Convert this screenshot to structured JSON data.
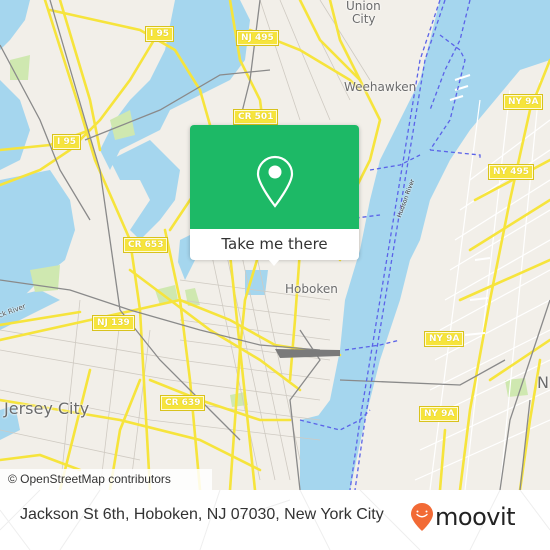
{
  "map": {
    "road_shields": [
      {
        "label": "I 95",
        "id": "i95-north"
      },
      {
        "label": "I 95",
        "id": "i95-west"
      },
      {
        "label": "NJ 495",
        "id": "nj495"
      },
      {
        "label": "CR 501",
        "id": "cr501"
      },
      {
        "label": "CR 653",
        "id": "cr653"
      },
      {
        "label": "NJ 139",
        "id": "nj139"
      },
      {
        "label": "CR 639",
        "id": "cr639"
      },
      {
        "label": "NY 9A",
        "id": "ny9a-north"
      },
      {
        "label": "NY 495",
        "id": "ny495"
      },
      {
        "label": "NY 9A",
        "id": "ny9a-mid"
      },
      {
        "label": "NY 9A",
        "id": "ny9a-south"
      }
    ],
    "place_labels": {
      "union_city_1": "Union",
      "union_city_2": "City",
      "weehawken": "Weehawken",
      "hoboken": "Hoboken",
      "jersey_city": "Jersey City",
      "new_york_partial": "N",
      "river_hackensack": "ck River",
      "river_hudson": "Hudson River"
    },
    "attribution": "© OpenStreetMap contributors",
    "colors": {
      "land": "#f2efe9",
      "water": "#a5d6ee",
      "road": "#f6e43c",
      "park": "#cfe8b0",
      "ferry": "#5b63e8"
    }
  },
  "popup": {
    "icon": "map-pin-icon",
    "action_label": "Take me there",
    "color": "#1db966"
  },
  "footer": {
    "address": "Jackson St 6th, Hoboken, NJ 07030, New York City",
    "brand": "moovit",
    "brand_color": "#f26a35"
  }
}
